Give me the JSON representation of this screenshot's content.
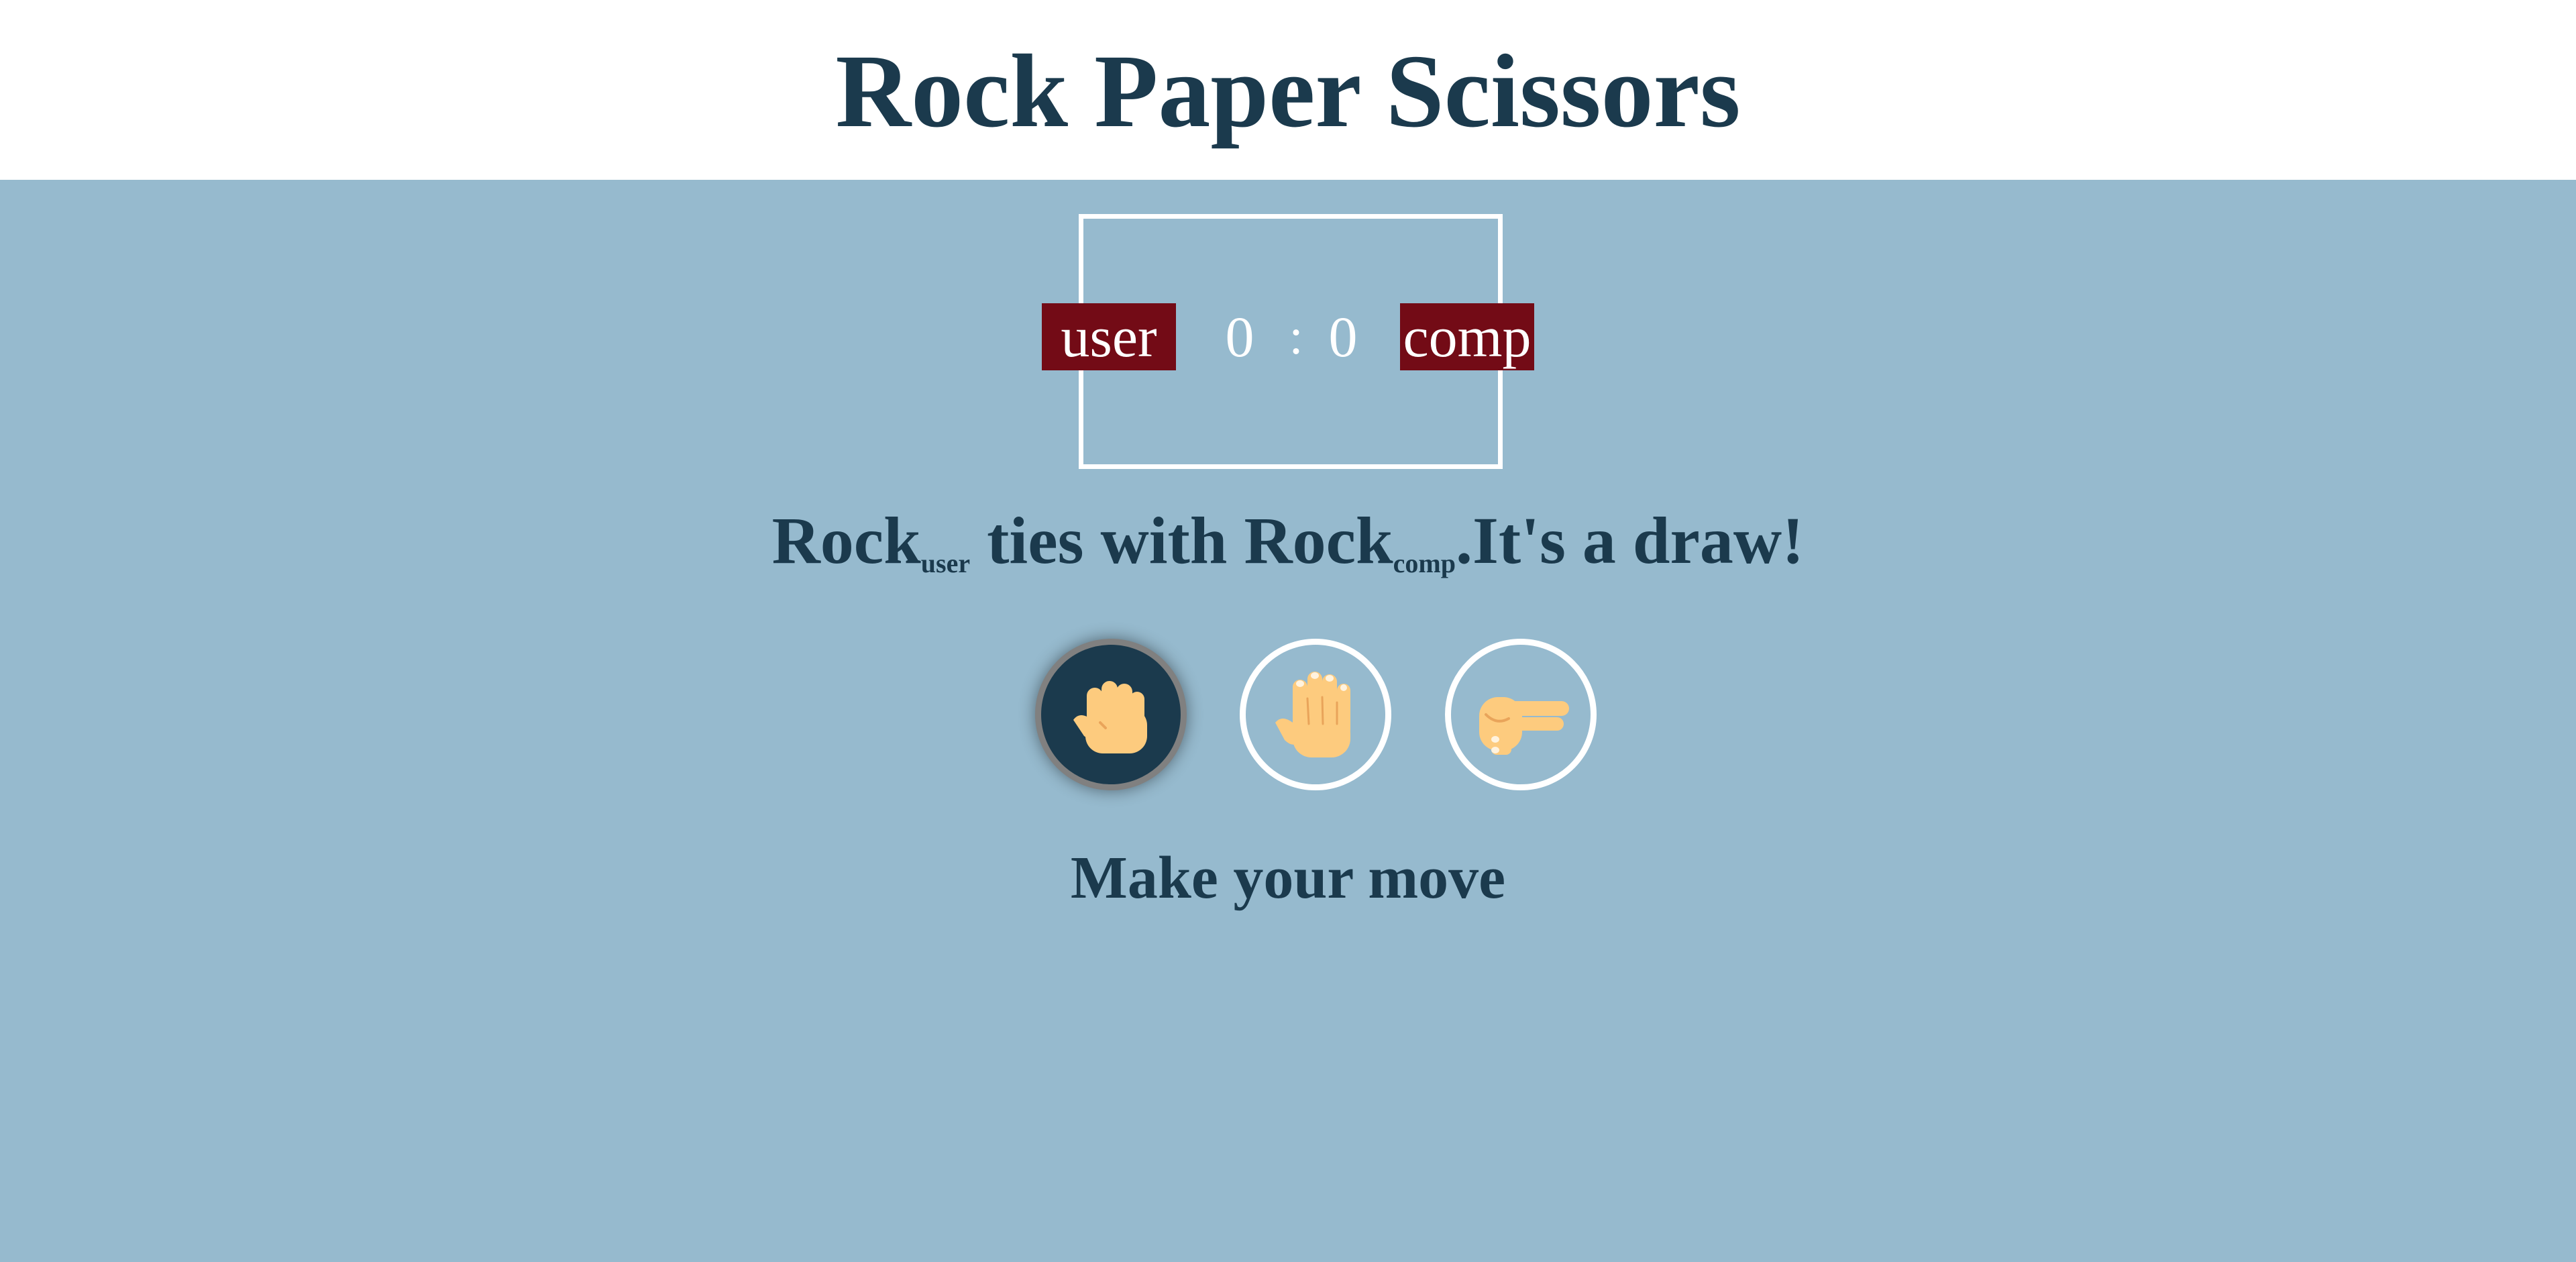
{
  "header": {
    "title": "Rock Paper Scissors"
  },
  "scoreboard": {
    "user_label": "user",
    "comp_label": "comp",
    "user_score": "0",
    "separator": ":",
    "comp_score": "0"
  },
  "result": {
    "user_move": "Rock",
    "user_sub": "user",
    "middle": " ties with ",
    "comp_move": "Rock",
    "comp_sub": "comp",
    "outcome": ".It's a draw!"
  },
  "choices": [
    {
      "name": "rock",
      "icon": "fist-icon",
      "selected": true
    },
    {
      "name": "paper",
      "icon": "open-hand-icon",
      "selected": false
    },
    {
      "name": "scissors",
      "icon": "v-sign-hand-icon",
      "selected": false
    }
  ],
  "prompt": "Make your move",
  "colors": {
    "background": "#96bace",
    "header_bg": "#ffffff",
    "text": "#1b3a4d",
    "badge": "#730b16",
    "skin": "#fdcb7e"
  }
}
